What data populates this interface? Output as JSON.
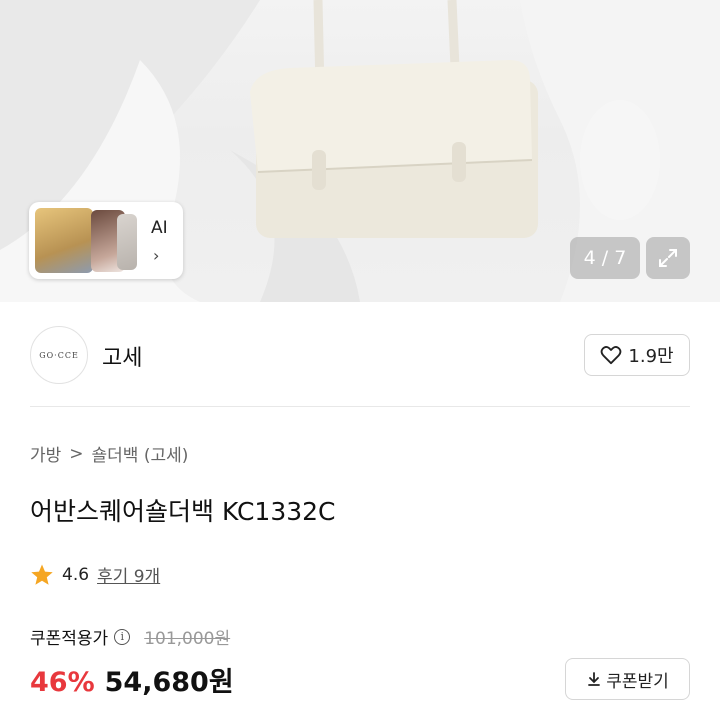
{
  "gallery": {
    "ai_label": "AI",
    "ai_chevron": "›",
    "counter": "4 / 7",
    "expand_icon": "expand-icon"
  },
  "brand": {
    "logo_text": "GO·CCE",
    "name": "고세",
    "like_count": "1.9만",
    "like_icon": "heart-icon"
  },
  "breadcrumb": {
    "level1": "가방",
    "separator": ">",
    "level2": "숄더백 (고세)"
  },
  "product": {
    "title": "어반스퀘어숄더백 KC1332C",
    "rating": "4.6",
    "reviews": "후기 9개"
  },
  "pricing": {
    "coupon_label": "쿠폰적용가",
    "original_price": "101,000원",
    "discount": "46%",
    "price": "54,680원",
    "coupon_button": "쿠폰받기",
    "accent_color": "#e8383d",
    "star_color": "#f5a623"
  }
}
